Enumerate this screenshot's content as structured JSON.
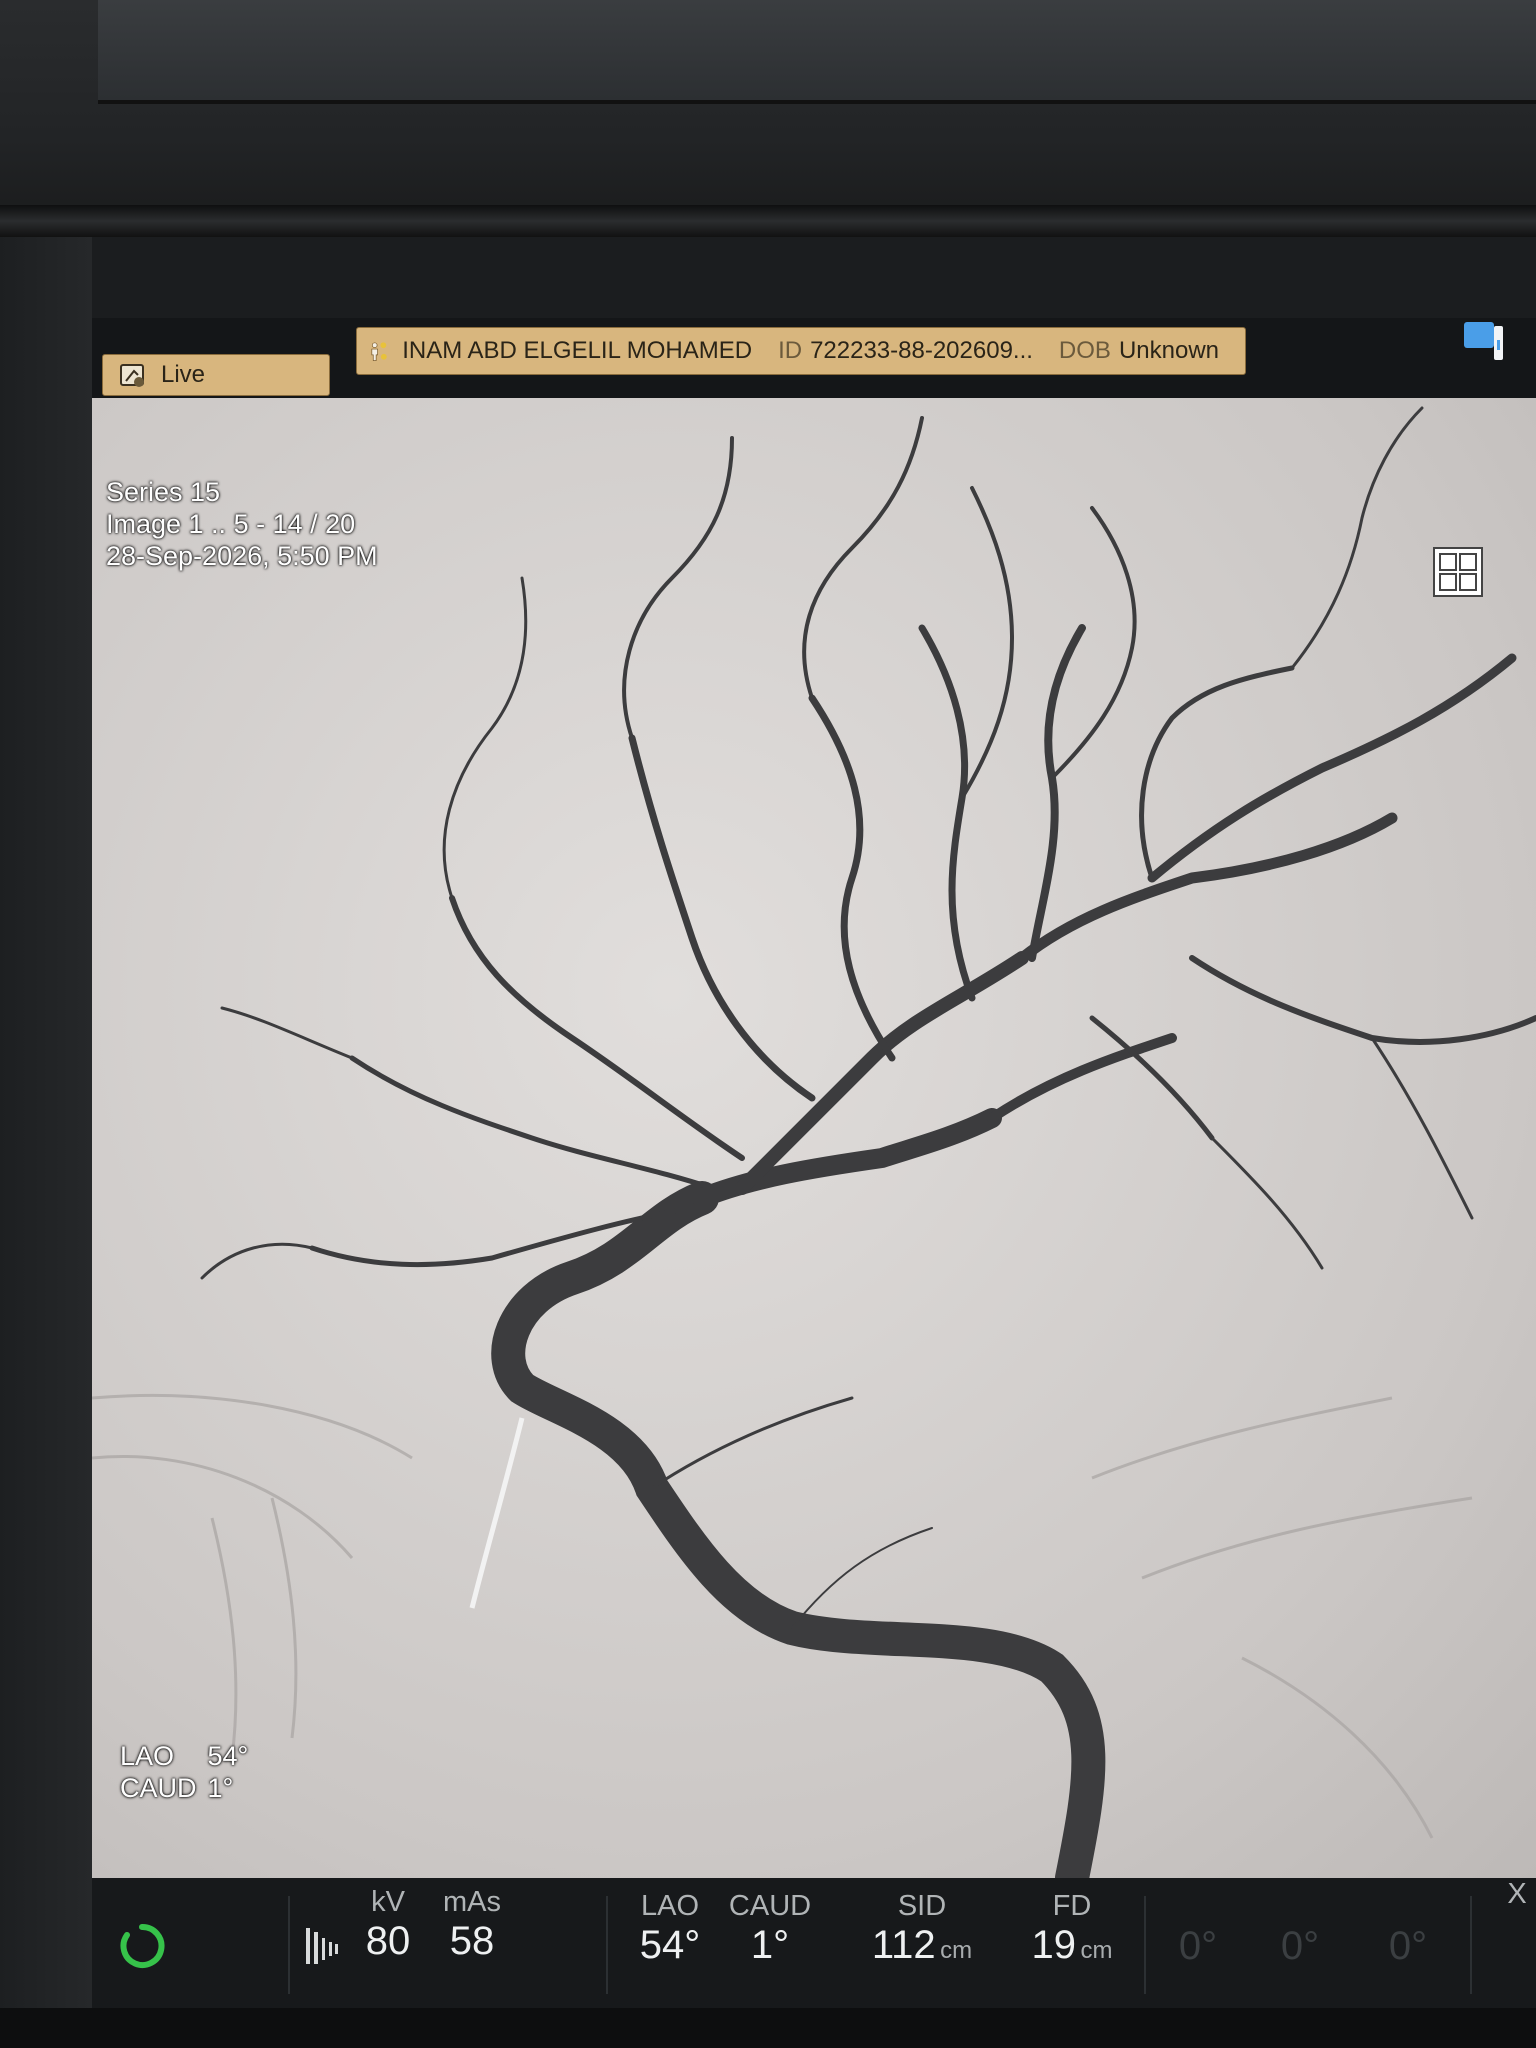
{
  "tabs": {
    "live_label": "Live"
  },
  "patient": {
    "name": "INAM ABD ELGELIL MOHAMED",
    "id_label": "ID",
    "id_value": "722233-88-202609...",
    "dob_label": "DOB",
    "dob_value": "Unknown"
  },
  "image_info": {
    "series": "Series 15",
    "image": "Image 1 .. 5 - 14 / 20",
    "datetime": "28-Sep-2026, 5:50 PM"
  },
  "angle_overlay": {
    "lao_label": "LAO",
    "lao_value": "54°",
    "caud_label": "CAUD",
    "caud_value": "1°"
  },
  "status_bar": {
    "kv_label": "kV",
    "kv_value": "80",
    "mas_label": "mAs",
    "mas_value": "58",
    "lao_label": "LAO",
    "lao_value": "54°",
    "caud_label": "CAUD",
    "caud_value": "1°",
    "sid_label": "SID",
    "sid_value": "112",
    "sid_unit": "cm",
    "fd_label": "FD",
    "fd_value": "19",
    "fd_unit": "cm",
    "disabled_1": "0°",
    "disabled_2": "0°",
    "disabled_3": "0°",
    "edge_label": "X"
  },
  "icons": [
    "live-camera-icon",
    "patient-icon",
    "monitor-icon",
    "layout-grid-icon",
    "acquiring-spinner-icon",
    "xray-pulse-icon"
  ],
  "colors": {
    "tab_bg": "#d8b67e",
    "spinner": "#36c24a",
    "vessel": "#3a3a3c",
    "image_bg": "#d9d6d4"
  }
}
